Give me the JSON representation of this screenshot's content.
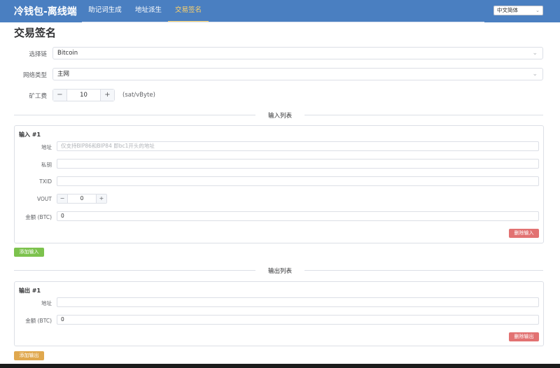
{
  "app": {
    "title": "冷钱包-离线端",
    "nav": [
      {
        "label": "助记词生成",
        "active": false
      },
      {
        "label": "地址派生",
        "active": false
      },
      {
        "label": "交易签名",
        "active": true
      }
    ],
    "language": "中文简体"
  },
  "page": {
    "title": "交易签名"
  },
  "form": {
    "chain_label": "选择链",
    "chain_value": "Bitcoin",
    "network_label": "网络类型",
    "network_value": "主网",
    "fee_label": "矿工费",
    "fee_value": "10",
    "fee_unit": "(sat/vByte)"
  },
  "inputs_section": {
    "title": "输入列表",
    "items": [
      {
        "title": "输入 #1",
        "address_label": "地址",
        "address_placeholder": "仅支持BIP86和BIP84 即bc1开头的地址",
        "private_key_label": "私钥",
        "private_key_value": "",
        "txid_label": "TXID",
        "txid_value": "",
        "vout_label": "VOUT",
        "vout_value": "0",
        "amount_label": "金额 (BTC)",
        "amount_value": "0",
        "delete_label": "删除输入"
      }
    ],
    "add_label": "添加输入"
  },
  "outputs_section": {
    "title": "输出列表",
    "items": [
      {
        "title": "输出 #1",
        "address_label": "地址",
        "address_value": "",
        "amount_label": "金额 (BTC)",
        "amount_value": "0",
        "delete_label": "删除输出"
      }
    ],
    "add_label": "添加输出"
  },
  "icons": {
    "minus": "−",
    "plus": "+",
    "chevron": "⌄"
  },
  "colors": {
    "header": "#4a7fc1",
    "active_tab": "#ffd36a",
    "danger": "#e27272",
    "success": "#7cc24d",
    "warning": "#e0a84e"
  }
}
